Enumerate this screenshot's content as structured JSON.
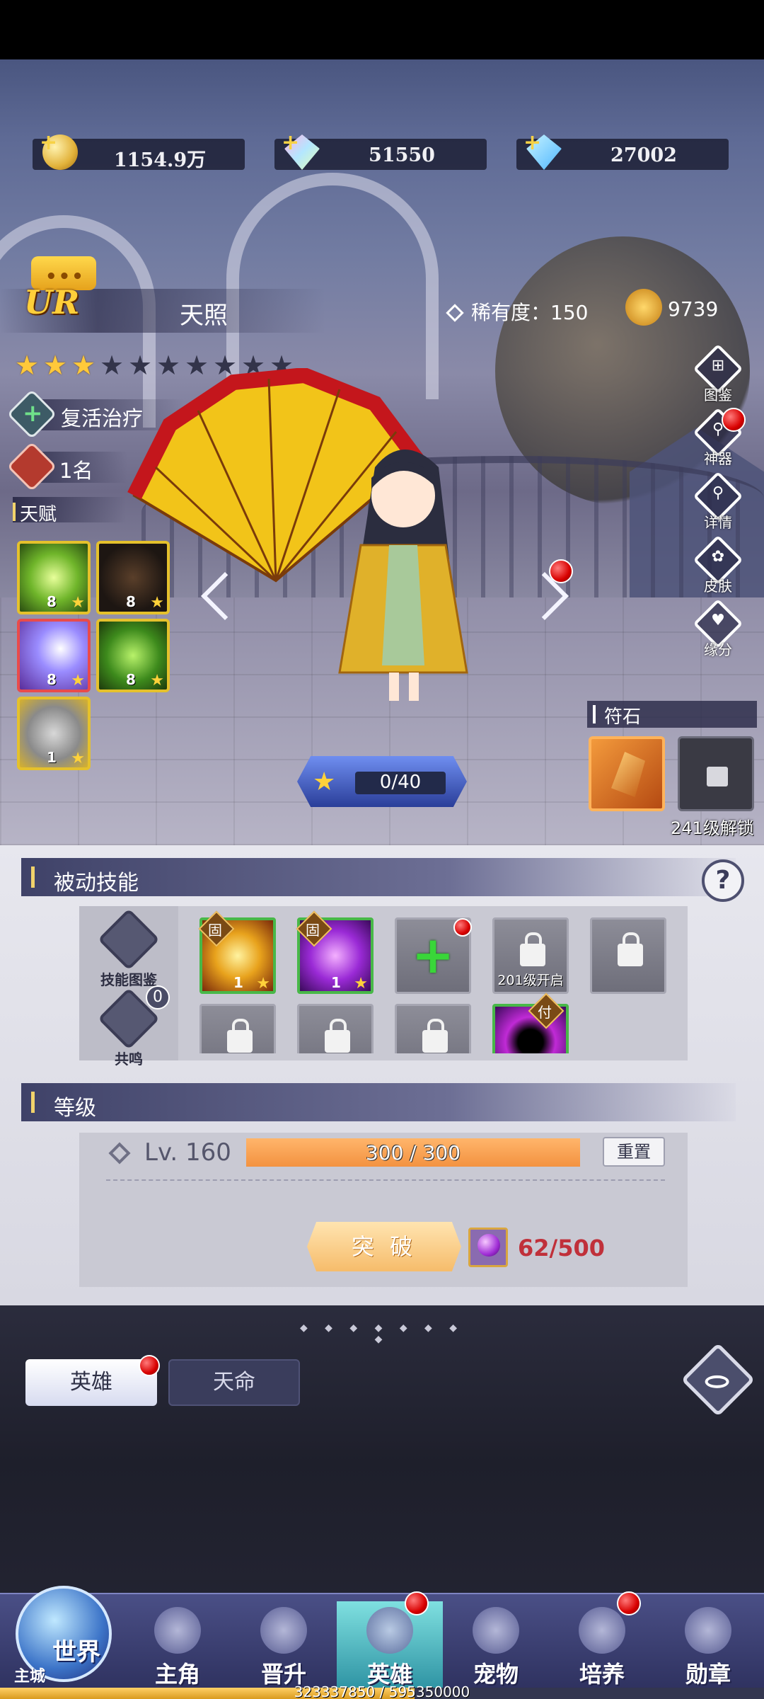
{
  "currency": [
    {
      "icon": "gold-coin-icon",
      "value": "1154.9万"
    },
    {
      "icon": "rainbow-diamond-icon",
      "value": "51550"
    },
    {
      "icon": "blue-diamond-icon",
      "value": "27002"
    }
  ],
  "hero": {
    "grade": "UR",
    "name": "天照",
    "rarity_label": "稀有度：150",
    "power": "9739",
    "stars_lit": 3,
    "stars_total": 10,
    "role": "复活治疗",
    "rank": "1名",
    "talent_label": "天赋",
    "talents": [
      {
        "icon": "green-vortex-icon",
        "level": "8"
      },
      {
        "icon": "shadow-figure-icon",
        "level": "8"
      },
      {
        "icon": "purple-wind-icon",
        "level": "8"
      },
      {
        "icon": "green-dragon-icon",
        "level": "8"
      },
      {
        "icon": "gray-spirit-icon",
        "level": "1"
      }
    ],
    "exp": "0/40"
  },
  "side_menu": [
    {
      "icon": "handbook-icon",
      "label": "图鉴",
      "badge": false
    },
    {
      "icon": "artifact-icon",
      "label": "神器",
      "badge": true
    },
    {
      "icon": "magnifier-icon",
      "label": "详情",
      "badge": false
    },
    {
      "icon": "skin-icon",
      "label": "皮肤",
      "badge": false
    },
    {
      "icon": "heart-icon",
      "label": "缘分",
      "badge": false
    }
  ],
  "rune": {
    "label": "符石",
    "unlock_text": "241级解锁"
  },
  "passive": {
    "title": "被动技能",
    "help": "?",
    "handbook_label": "技能图鉴",
    "resonance_label": "共鸣",
    "resonance_count": "0",
    "slots": [
      {
        "type": "skill",
        "tag": "固",
        "level": "1"
      },
      {
        "type": "skill",
        "tag": "固",
        "level": "1"
      },
      {
        "type": "add"
      },
      {
        "type": "locked",
        "caption": "201级开启"
      },
      {
        "type": "locked",
        "caption": ""
      },
      {
        "type": "locked",
        "caption": ""
      },
      {
        "type": "locked",
        "caption": ""
      },
      {
        "type": "locked",
        "caption": ""
      },
      {
        "type": "skill",
        "tag": "付",
        "level": ""
      }
    ]
  },
  "level": {
    "title": "等级",
    "lv": "Lv. 160",
    "progress": "300 / 300",
    "progress_fraction": 1.0,
    "reset": "重置",
    "breakthrough": "突 破",
    "material": "62/500"
  },
  "tabs": {
    "hero": "英雄",
    "fate": "天命"
  },
  "nav": {
    "world": "世界",
    "world_sub": "主城",
    "items": [
      "主角",
      "晋升",
      "英雄",
      "宠物",
      "培养",
      "勋章"
    ],
    "active_index": 2,
    "badges": [
      false,
      false,
      true,
      false,
      true,
      false
    ]
  },
  "account_exp": {
    "text": "323337850 / 595350000",
    "fraction": 0.543
  },
  "colors": {
    "accent_gold": "#ffc93a",
    "badge_red": "#d80000",
    "material_red": "#c0303a"
  }
}
